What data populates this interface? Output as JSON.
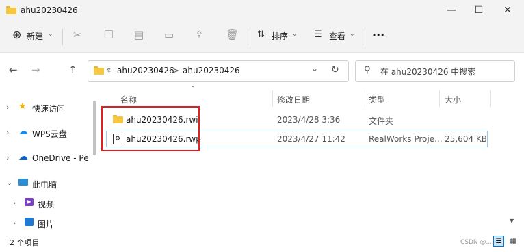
{
  "window": {
    "title": "ahu20230426",
    "minimize_glyph": "—",
    "maximize_glyph": "☐",
    "close_glyph": "✕"
  },
  "toolbar": {
    "new_label": "新建",
    "sort_label": "排序",
    "view_label": "查看",
    "more_label": "···"
  },
  "nav": {
    "back": "←",
    "forward": "→",
    "up": "↑",
    "refresh": "↻",
    "dropdown": "⌄"
  },
  "address": {
    "overflow": "«",
    "crumbs": [
      "ahu20230426",
      "ahu20230426"
    ],
    "separator": ">"
  },
  "search": {
    "placeholder": "在 ahu20230426 中搜索"
  },
  "sidebar": {
    "items": [
      {
        "label": "快速访问",
        "icon": "star-icon"
      },
      {
        "label": "WPS云盘",
        "icon": "cloud-icon"
      },
      {
        "label": "OneDrive - Pers",
        "icon": "onedrive-icon"
      },
      {
        "label": "此电脑",
        "icon": "computer-icon"
      },
      {
        "label": "视频",
        "icon": "video-icon"
      },
      {
        "label": "图片",
        "icon": "picture-icon"
      }
    ]
  },
  "columns": {
    "name": "名称",
    "date": "修改日期",
    "type": "类型",
    "size": "大小"
  },
  "files": [
    {
      "name": "ahu20230426.rwi",
      "date": "2023/4/28 3:36",
      "type": "文件夹",
      "size": "",
      "icon": "folder-icon"
    },
    {
      "name": "ahu20230426.rwp",
      "date": "2023/4/27 11:42",
      "type": "RealWorks Proje...",
      "size": "25,604 KB",
      "icon": "rwp-file-icon"
    }
  ],
  "status": {
    "item_count": "2 个项目",
    "watermark": "CSDN @..."
  },
  "colors": {
    "highlight_border": "#e02020",
    "selection_border": "#99c9ef",
    "folder_yellow": "#f6c842",
    "accent_blue": "#0078d4"
  }
}
